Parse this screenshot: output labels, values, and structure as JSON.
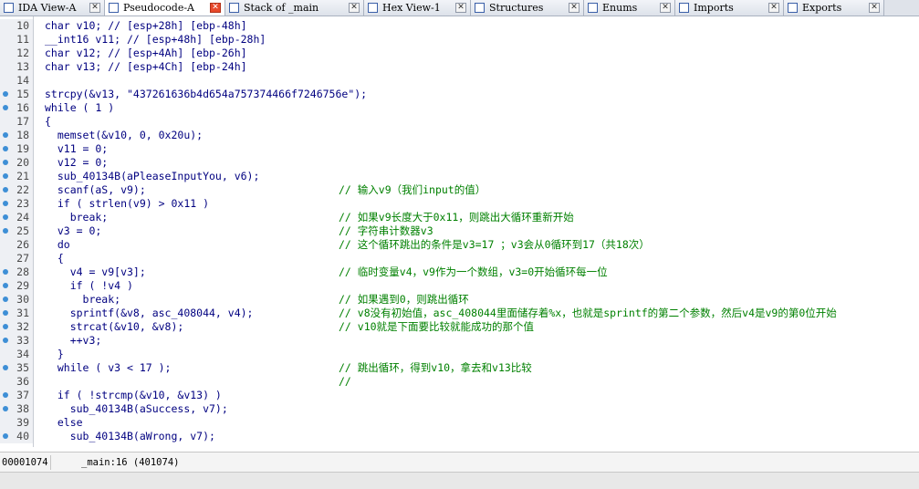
{
  "tabs": [
    {
      "label": "IDA View-A",
      "icon": "disasm-view-icon",
      "active": false
    },
    {
      "label": "Pseudocode-A",
      "icon": "pseudocode-icon",
      "active": true
    },
    {
      "label": "Stack of _main",
      "icon": "stack-icon",
      "active": false
    },
    {
      "label": "Hex View-1",
      "icon": "hex-icon",
      "active": false
    },
    {
      "label": "Structures",
      "icon": "structures-icon",
      "active": false
    },
    {
      "label": "Enums",
      "icon": "enums-icon",
      "active": false
    },
    {
      "label": "Imports",
      "icon": "imports-icon",
      "active": false
    },
    {
      "label": "Exports",
      "icon": "exports-icon",
      "active": false
    }
  ],
  "close_glyph": "✕",
  "colors": {
    "keyword": "#000080",
    "comment": "#008000",
    "var": "#808080",
    "string": "#008000",
    "breakpoint_dot": "#3e8fd6"
  },
  "lines": [
    {
      "num": "10",
      "dot": false,
      "code": "char v10; // [esp+28h] [ebp-48h]",
      "comment": ""
    },
    {
      "num": "11",
      "dot": false,
      "code": "__int16 v11; // [esp+48h] [ebp-28h]",
      "comment": ""
    },
    {
      "num": "12",
      "dot": false,
      "code": "char v12; // [esp+4Ah] [ebp-26h]",
      "comment": ""
    },
    {
      "num": "13",
      "dot": false,
      "code": "char v13; // [esp+4Ch] [ebp-24h]",
      "comment": ""
    },
    {
      "num": "14",
      "dot": false,
      "code": "",
      "comment": ""
    },
    {
      "num": "15",
      "dot": true,
      "code": "strcpy(&v13, \"437261636b4d654a757374466f7246756e\");",
      "comment": ""
    },
    {
      "num": "16",
      "dot": true,
      "code": "while ( 1 )",
      "comment": ""
    },
    {
      "num": "17",
      "dot": false,
      "code": "{",
      "comment": ""
    },
    {
      "num": "18",
      "dot": true,
      "code": "  memset(&v10, 0, 0x20u);",
      "comment": ""
    },
    {
      "num": "19",
      "dot": true,
      "code": "  v11 = 0;",
      "comment": ""
    },
    {
      "num": "20",
      "dot": true,
      "code": "  v12 = 0;",
      "comment": ""
    },
    {
      "num": "21",
      "dot": true,
      "code": "  sub_40134B(aPleaseInputYou, v6);",
      "comment": ""
    },
    {
      "num": "22",
      "dot": true,
      "code": "  scanf(aS, v9);",
      "comment": "// 输入v9（我们input的值）"
    },
    {
      "num": "23",
      "dot": true,
      "code": "  if ( strlen(v9) > 0x11 )",
      "comment": ""
    },
    {
      "num": "24",
      "dot": true,
      "code": "    break;",
      "comment": "// 如果v9长度大于0x11，则跳出大循环重新开始"
    },
    {
      "num": "25",
      "dot": true,
      "code": "  v3 = 0;",
      "comment": "// 字符串计数器v3"
    },
    {
      "num": "26",
      "dot": false,
      "code": "  do",
      "comment": "// 这个循环跳出的条件是v3=17 ；v3会从0循环到17（共18次）"
    },
    {
      "num": "27",
      "dot": false,
      "code": "  {",
      "comment": ""
    },
    {
      "num": "28",
      "dot": true,
      "code": "    v4 = v9[v3];",
      "comment": "// 临时变量v4，v9作为一个数组，v3=0开始循环每一位"
    },
    {
      "num": "29",
      "dot": true,
      "code": "    if ( !v4 )",
      "comment": ""
    },
    {
      "num": "30",
      "dot": true,
      "code": "      break;",
      "comment": "// 如果遇到0，则跳出循环"
    },
    {
      "num": "31",
      "dot": true,
      "code": "    sprintf(&v8, asc_408044, v4);",
      "comment": "// v8没有初始值，asc_408044里面储存着%x，也就是sprintf的第二个参数，然后v4是v9的第0位开始"
    },
    {
      "num": "32",
      "dot": true,
      "code": "    strcat(&v10, &v8);",
      "comment": "// v10就是下面要比较就能成功的那个值"
    },
    {
      "num": "33",
      "dot": true,
      "code": "    ++v3;",
      "comment": ""
    },
    {
      "num": "34",
      "dot": false,
      "code": "  }",
      "comment": ""
    },
    {
      "num": "35",
      "dot": true,
      "code": "  while ( v3 < 17 );",
      "comment": "// 跳出循环，得到v10，拿去和v13比较"
    },
    {
      "num": "36",
      "dot": false,
      "code": "",
      "comment": "//"
    },
    {
      "num": "37",
      "dot": true,
      "code": "  if ( !strcmp(&v10, &v13) )",
      "comment": ""
    },
    {
      "num": "38",
      "dot": true,
      "code": "    sub_40134B(aSuccess, v7);",
      "comment": ""
    },
    {
      "num": "39",
      "dot": false,
      "code": "  else",
      "comment": ""
    },
    {
      "num": "40",
      "dot": true,
      "code": "    sub_40134B(aWrong, v7);",
      "comment": ""
    }
  ],
  "status": {
    "address": "00001074",
    "location": "_main:16 (401074)"
  }
}
